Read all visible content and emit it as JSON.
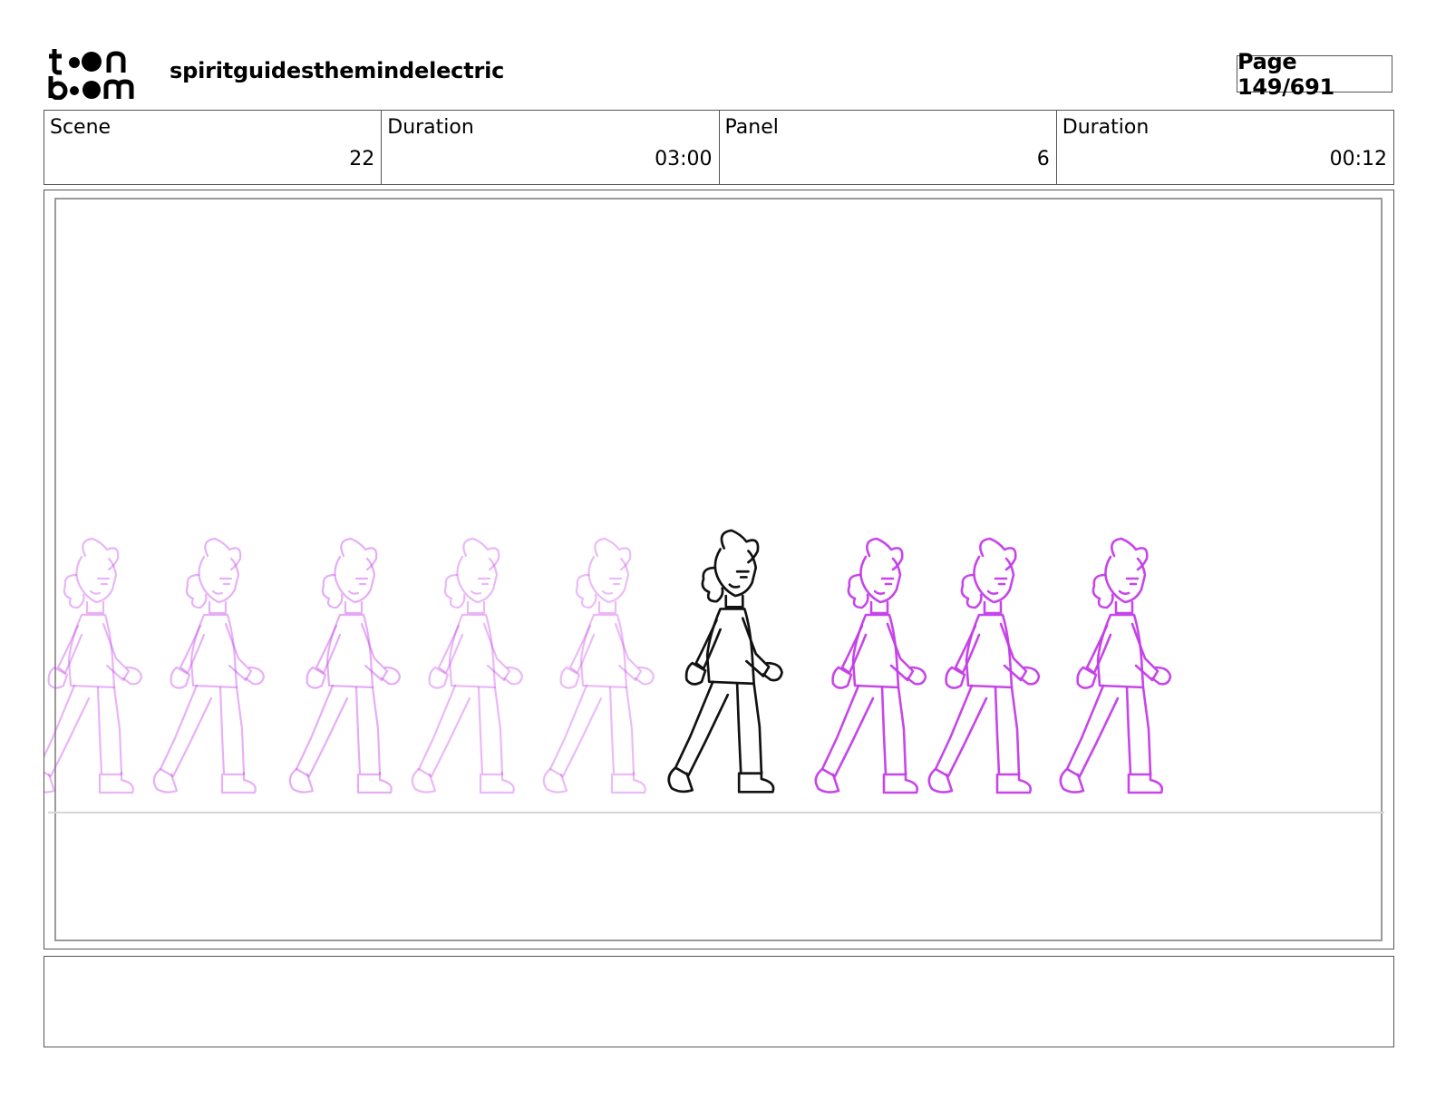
{
  "logo": {
    "line1": "toon",
    "line2": "boom"
  },
  "header": {
    "project_title": "spiritguidesthemindelectric",
    "page_label": "Page 149/691"
  },
  "info": [
    {
      "label": "Scene",
      "value": "22"
    },
    {
      "label": "Duration",
      "value": "03:00"
    },
    {
      "label": "Panel",
      "value": "6"
    },
    {
      "label": "Duration",
      "value": "00:12"
    }
  ],
  "panel": {
    "onion_skin_color": "#c43ce8",
    "line_color": "#111111"
  },
  "notes": {
    "text": ""
  }
}
